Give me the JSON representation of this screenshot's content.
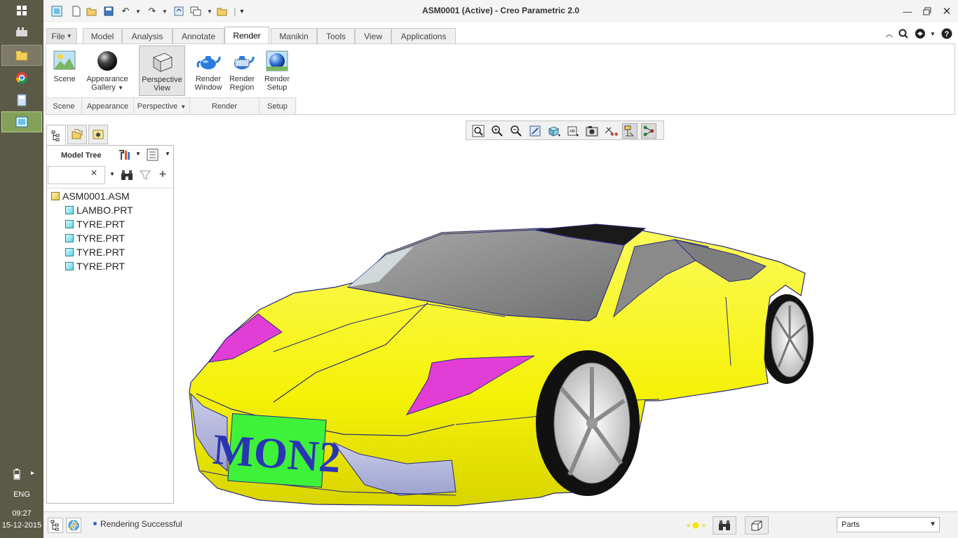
{
  "window": {
    "title": "ASM0001 (Active) - Creo Parametric 2.0"
  },
  "taskbar": {
    "language": "ENG",
    "time": "09:27",
    "date": "15-12-2015"
  },
  "ribbon": {
    "tabs": [
      {
        "label": "File",
        "has_dropdown": true
      },
      {
        "label": "Model"
      },
      {
        "label": "Analysis"
      },
      {
        "label": "Annotate"
      },
      {
        "label": "Render",
        "active": true
      },
      {
        "label": "Manikin"
      },
      {
        "label": "Tools"
      },
      {
        "label": "View"
      },
      {
        "label": "Applications"
      }
    ],
    "buttons": {
      "scene": "Scene",
      "appearance_gallery_1": "Appearance",
      "appearance_gallery_2": "Gallery",
      "perspective_view_1": "Perspective",
      "perspective_view_2": "View",
      "render_window_1": "Render",
      "render_window_2": "Window",
      "render_region_1": "Render",
      "render_region_2": "Region",
      "render_setup_1": "Render",
      "render_setup_2": "Setup"
    },
    "groups": {
      "scene": "Scene",
      "appearance": "Appearance",
      "perspective": "Perspective",
      "render": "Render",
      "setup": "Setup"
    }
  },
  "model_tree": {
    "label": "Model Tree",
    "search_value": "",
    "items": [
      {
        "name": "ASM0001.ASM",
        "type": "assembly",
        "level": 0
      },
      {
        "name": "LAMBO.PRT",
        "type": "part",
        "level": 1
      },
      {
        "name": "TYRE.PRT",
        "type": "part",
        "level": 1
      },
      {
        "name": "TYRE.PRT",
        "type": "part",
        "level": 1
      },
      {
        "name": "TYRE.PRT",
        "type": "part",
        "level": 1
      },
      {
        "name": "TYRE.PRT",
        "type": "part",
        "level": 1
      }
    ]
  },
  "graphics": {
    "license_plate": "MON2",
    "body_color": "#f5f207",
    "accent_color": "#e23ed6",
    "plate_color": "#3ef23a",
    "plate_text_color": "#2a35b4"
  },
  "status": {
    "message": "Rendering Successful",
    "filter_value": "Parts"
  }
}
